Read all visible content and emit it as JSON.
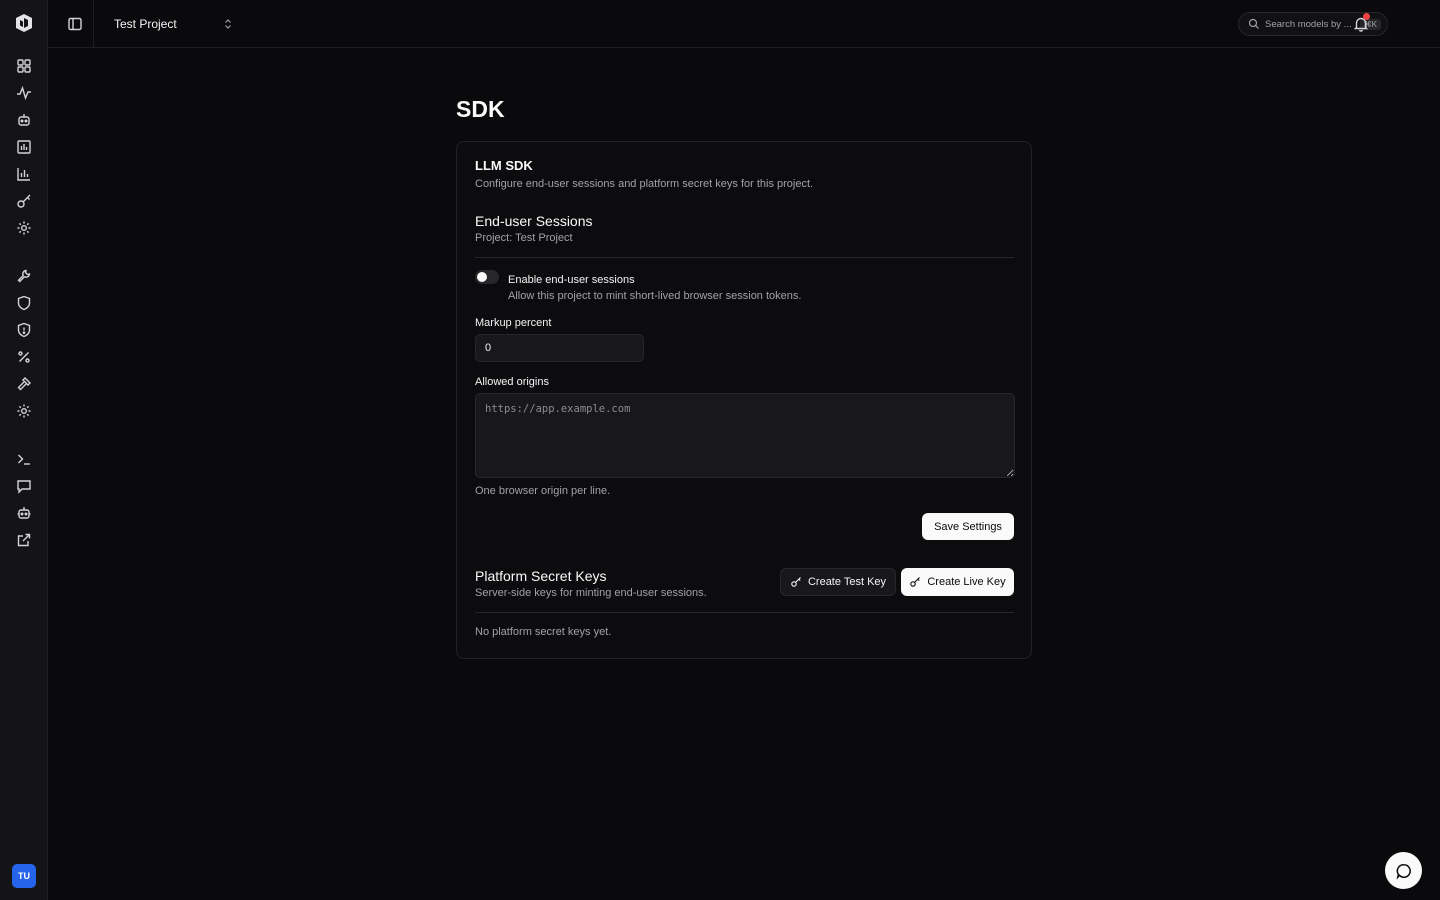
{
  "header": {
    "project_name": "Test Project",
    "search_placeholder": "Search models by ...",
    "search_shortcut": "⌘K"
  },
  "sidebar": {
    "avatar_initials": "TU",
    "icons": [
      "dashboard-icon",
      "activity-icon",
      "bot-icon",
      "bar-chart-icon",
      "chart-icon",
      "key-icon",
      "settings-icon",
      "wrench-icon",
      "shield-icon",
      "shield-alert-icon",
      "percent-icon",
      "hammer-icon",
      "gear-icon",
      "terminal-icon",
      "message-icon",
      "robot-icon",
      "external-link-icon"
    ]
  },
  "page": {
    "title": "SDK",
    "card": {
      "title": "LLM SDK",
      "description": "Configure end-user sessions and platform secret keys for this project.",
      "sessions": {
        "title": "End-user Sessions",
        "project_label": "Project: Test Project",
        "toggle_label": "Enable end-user sessions",
        "toggle_description": "Allow this project to mint short-lived browser session tokens.",
        "toggle_enabled": false,
        "markup_label": "Markup percent",
        "markup_value": "0",
        "origins_label": "Allowed origins",
        "origins_placeholder": "https://app.example.com",
        "origins_help": "One browser origin per line.",
        "save_label": "Save Settings"
      },
      "keys": {
        "title": "Platform Secret Keys",
        "description": "Server-side keys for minting end-user sessions.",
        "create_test_label": "Create Test Key",
        "create_live_label": "Create Live Key",
        "empty_text": "No platform secret keys yet."
      }
    }
  },
  "colors": {
    "background": "#0a0a0c",
    "sidebar": "#141416",
    "avatar": "#2563eb",
    "notification_dot": "#ef4444"
  }
}
